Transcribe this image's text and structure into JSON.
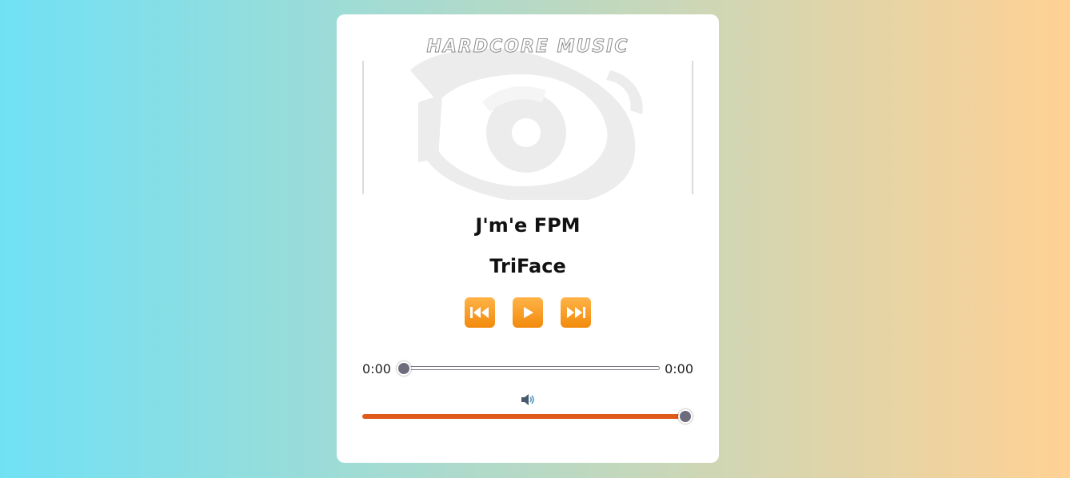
{
  "player": {
    "cover": {
      "wordmark": "HARDCORE MUSIC",
      "alt_icon": "tribal-swirl-logo-icon"
    },
    "song_title": "J'm'e FPM",
    "artist": "TriFace",
    "controls": {
      "prev_icon": "previous-track-icon",
      "play_icon": "play-icon",
      "next_icon": "next-track-icon",
      "button_color": "#f5a020"
    },
    "progress": {
      "current_time": "0:00",
      "total_time": "0:00",
      "fraction": 0
    },
    "volume": {
      "icon": "speaker-icon",
      "fraction": 1,
      "fill_color": "#e05a1c"
    }
  },
  "colors": {
    "background_left": "#70e1f5",
    "background_right": "#ffd194",
    "thumb": "#6d6c7c"
  }
}
